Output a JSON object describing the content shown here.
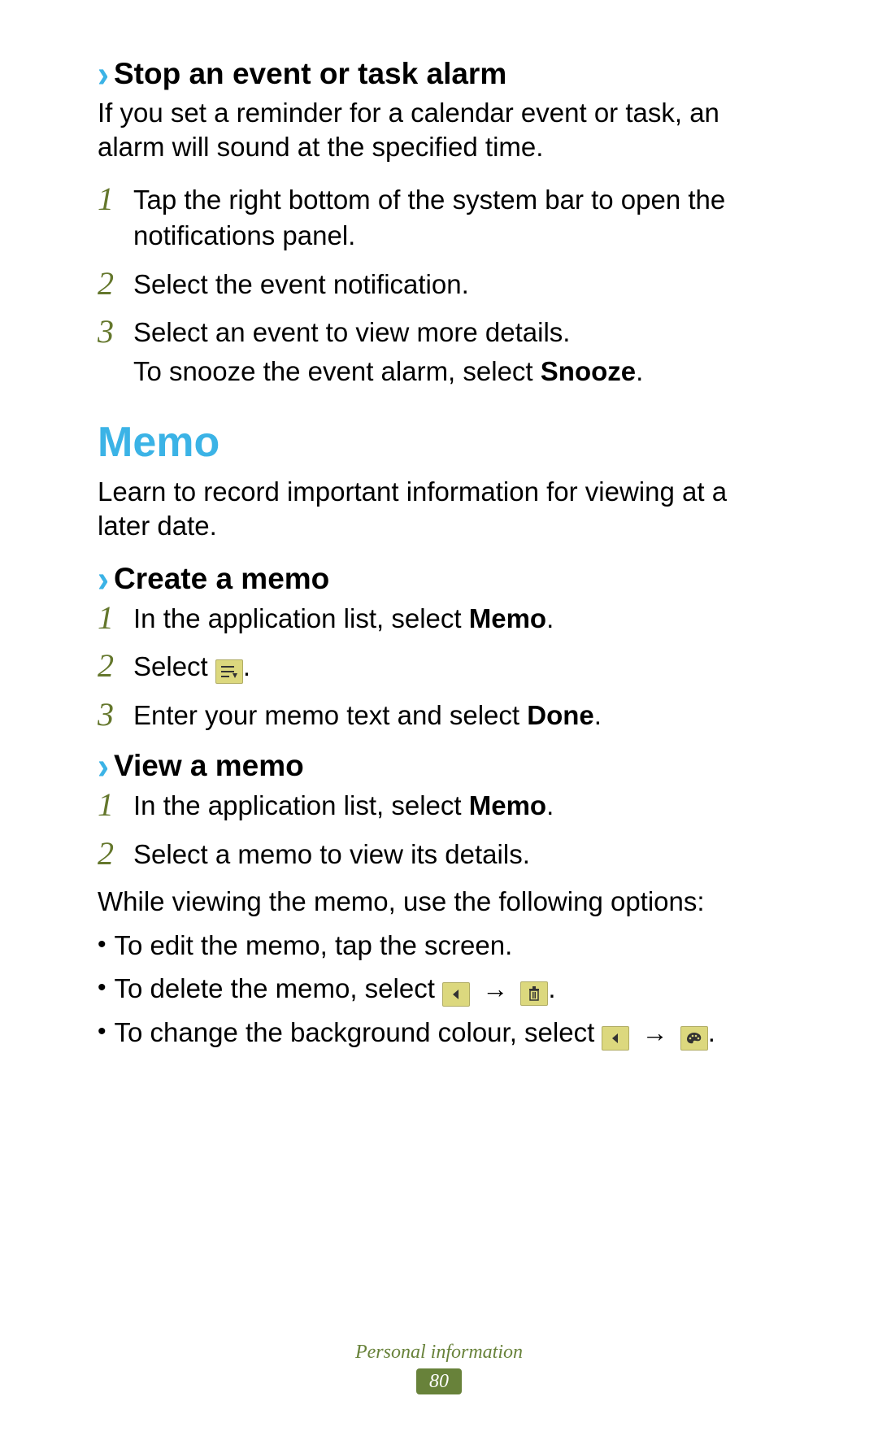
{
  "section1": {
    "heading": "Stop an event or task alarm",
    "intro": "If you set a reminder for a calendar event or task, an alarm will sound at the specified time.",
    "steps": [
      {
        "text": "Tap the right bottom of the system bar to open the notifications panel."
      },
      {
        "text": "Select the event notification."
      },
      {
        "text": "Select an event to view more details.",
        "extra_pre": "To snooze the event alarm, select ",
        "extra_bold": "Snooze",
        "extra_post": "."
      }
    ]
  },
  "memo": {
    "title": "Memo",
    "intro": "Learn to record important information for viewing at a later date."
  },
  "create": {
    "heading": "Create a memo",
    "step1_pre": "In the application list, select ",
    "step1_bold": "Memo",
    "step1_post": ".",
    "step2_pre": "Select ",
    "step2_icon": "new-memo-icon",
    "step2_post": ".",
    "step3_pre": "Enter your memo text and select ",
    "step3_bold": "Done",
    "step3_post": "."
  },
  "view": {
    "heading": "View a memo",
    "step1_pre": "In the application list, select ",
    "step1_bold": "Memo",
    "step1_post": ".",
    "step2": "Select a memo to view its details.",
    "options_intro": "While viewing the memo, use the following options:",
    "b1": "To edit the memo, tap the screen.",
    "b2_pre": "To delete the memo, select ",
    "b3_pre": "To change the background colour, select ",
    "arrow": "→",
    "post_period": "."
  },
  "nums": {
    "n1": "1",
    "n2": "2",
    "n3": "3"
  },
  "footer": {
    "section": "Personal information",
    "page": "80"
  }
}
